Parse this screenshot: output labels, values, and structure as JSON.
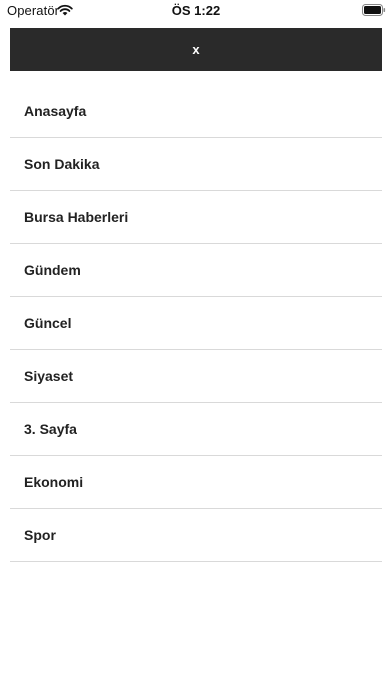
{
  "status_bar": {
    "carrier": "Operatör",
    "time": "ÖS 1:22",
    "icons": [
      "wifi-icon",
      "battery-icon"
    ]
  },
  "header": {
    "close_label": "x",
    "background": "#2a2a2a"
  },
  "menu": {
    "items": [
      {
        "label": "Anasayfa"
      },
      {
        "label": "Son Dakika"
      },
      {
        "label": "Bursa Haberleri"
      },
      {
        "label": "Gündem"
      },
      {
        "label": "Güncel"
      },
      {
        "label": "Siyaset"
      },
      {
        "label": "3. Sayfa"
      },
      {
        "label": "Ekonomi"
      },
      {
        "label": "Spor"
      }
    ]
  }
}
